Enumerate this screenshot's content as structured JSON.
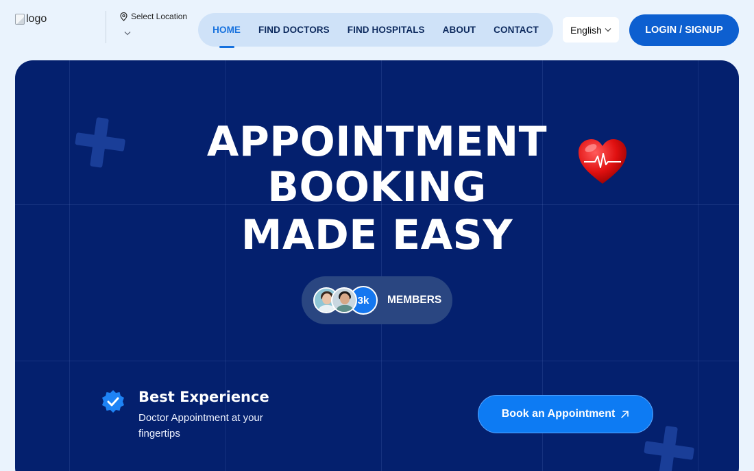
{
  "header": {
    "logo_alt": "logo",
    "location_label": "Select Location",
    "nav": [
      {
        "label": "HOME",
        "active": true
      },
      {
        "label": "FIND DOCTORS",
        "active": false
      },
      {
        "label": "FIND HOSPITALS",
        "active": false
      },
      {
        "label": "ABOUT",
        "active": false
      },
      {
        "label": "CONTACT",
        "active": false
      }
    ],
    "language": "English",
    "login_label": "LOGIN / SIGNUP"
  },
  "hero": {
    "title_lines": [
      "APPOINTMENT",
      "BOOKING",
      "MADE EASY"
    ],
    "members": {
      "count": "3k",
      "label": "MEMBERS"
    },
    "feature": {
      "title": "Best Experience",
      "description": "Doctor Appointment at your fingertips"
    },
    "cta_label": "Book an Appointment"
  },
  "colors": {
    "page_bg": "#eaf3fd",
    "hero_bg": "#04206e",
    "accent": "#1671de",
    "cta": "#0d7bf3",
    "nav_bg": "#cfe2f8"
  },
  "icons": [
    "location-pin-icon",
    "chevron-down-icon",
    "arrow-up-right-icon",
    "verified-badge-icon",
    "heart-pulse-icon",
    "plus-decoration-icon"
  ]
}
